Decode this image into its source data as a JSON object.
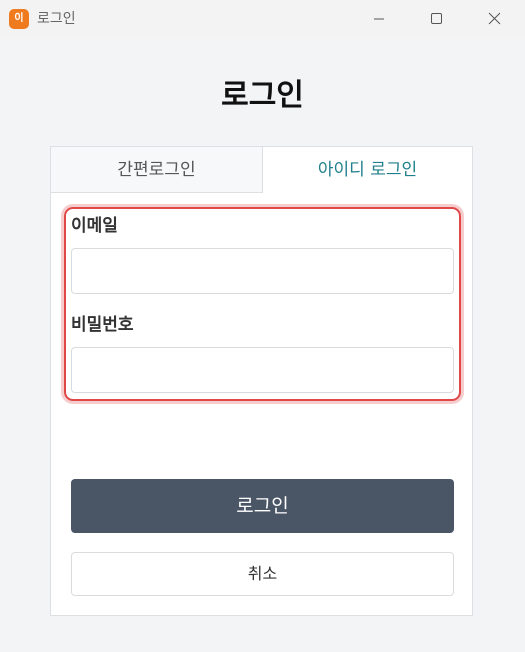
{
  "window": {
    "app_icon_text": "이",
    "title": "로그인"
  },
  "page": {
    "title": "로그인"
  },
  "tabs": [
    {
      "label": "간편로그인",
      "active": false
    },
    {
      "label": "아이디 로그인",
      "active": true
    }
  ],
  "form": {
    "email_label": "이메일",
    "email_value": "",
    "password_label": "비밀번호",
    "password_value": ""
  },
  "buttons": {
    "login_label": "로그인",
    "cancel_label": "취소"
  },
  "colors": {
    "accent_tab": "#1f7f8c",
    "primary_button": "#4a5566",
    "highlight_border": "#e04848"
  },
  "icons": {
    "minimize": "minimize-icon",
    "maximize": "maximize-icon",
    "close": "close-icon"
  }
}
